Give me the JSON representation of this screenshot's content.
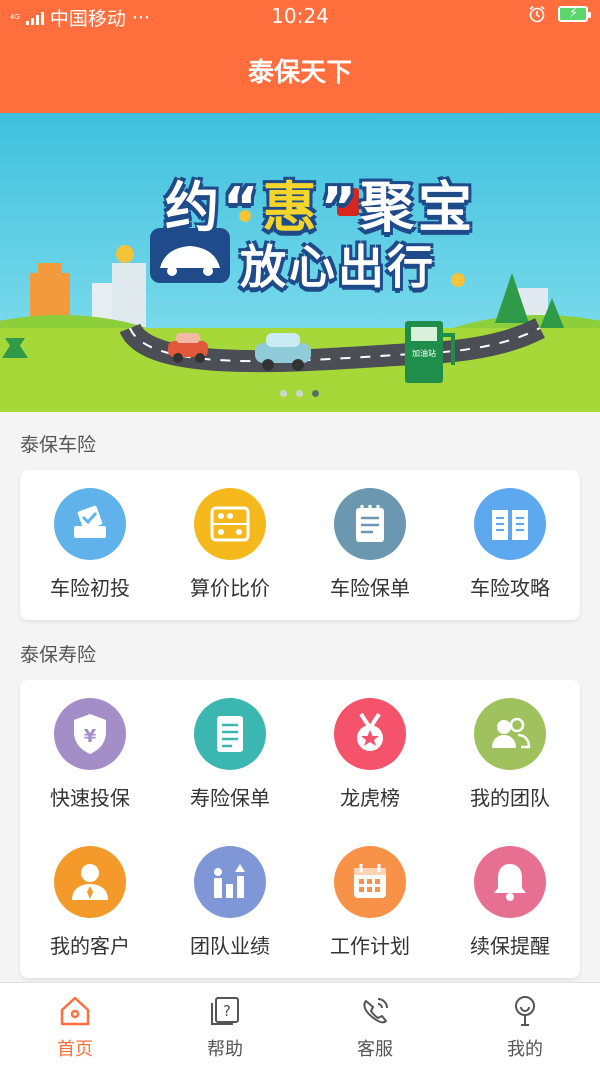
{
  "status_bar": {
    "network": "4G",
    "carrier": "中国移动",
    "more": "···",
    "time": "10:24"
  },
  "header": {
    "title": "泰保天下"
  },
  "banner": {
    "line1_pre": "约“",
    "line1_hui": "惠",
    "line1_post": "”聚宝",
    "line2": "放心出行",
    "station_label": "加油站",
    "slide_index": 3,
    "slide_count": 3
  },
  "sections": [
    {
      "title": "泰保车险",
      "items": [
        {
          "label": "车险初投",
          "icon": "vote-box-icon",
          "color": "#5fb3ea"
        },
        {
          "label": "算价比价",
          "icon": "abacus-icon",
          "color": "#f5b91d"
        },
        {
          "label": "车险保单",
          "icon": "notepad-icon",
          "color": "#6b97b0"
        },
        {
          "label": "车险攻略",
          "icon": "open-book-icon",
          "color": "#5ea8ef"
        }
      ]
    },
    {
      "title": "泰保寿险",
      "items": [
        {
          "label": "快速投保",
          "icon": "yen-shield-icon",
          "color": "#a38ec7"
        },
        {
          "label": "寿险保单",
          "icon": "document-icon",
          "color": "#3cb6b0"
        },
        {
          "label": "龙虎榜",
          "icon": "medal-icon",
          "color": "#f4536b"
        },
        {
          "label": "我的团队",
          "icon": "team-icon",
          "color": "#9fc25e"
        },
        {
          "label": "我的客户",
          "icon": "customer-icon",
          "color": "#f39a2b"
        },
        {
          "label": "团队业绩",
          "icon": "growth-chart-icon",
          "color": "#7f97d6"
        },
        {
          "label": "工作计划",
          "icon": "calendar-icon",
          "color": "#f79248"
        },
        {
          "label": "续保提醒",
          "icon": "bell-icon",
          "color": "#e76f91"
        }
      ]
    }
  ],
  "tabbar": [
    {
      "label": "首页",
      "icon": "home-icon",
      "active": true
    },
    {
      "label": "帮助",
      "icon": "help-icon",
      "active": false
    },
    {
      "label": "客服",
      "icon": "phone-icon",
      "active": false
    },
    {
      "label": "我的",
      "icon": "profile-icon",
      "active": false
    }
  ],
  "colors": {
    "accent": "#ff6e3c",
    "page_bg": "#f4f4f4"
  }
}
